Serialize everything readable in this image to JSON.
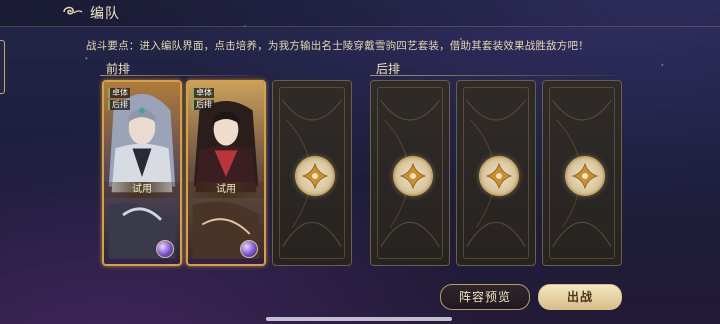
{
  "header": {
    "title": "编队"
  },
  "tip": "战斗要点：进入编队界面，点击培养，为我方输出名士陵穿戴雪驹四艺套装，借助其套装效果战胜敌方吧！",
  "sections": {
    "front": "前排",
    "back": "后排"
  },
  "front_slots": [
    {
      "tags": [
        "卓体",
        "后排"
      ],
      "trial_label": "试用"
    },
    {
      "tags": [
        "卓体",
        "后排"
      ],
      "trial_label": "试用"
    }
  ],
  "buttons": {
    "preview": "阵容预览",
    "sortie": "出战"
  },
  "colors": {
    "gold": "#c9a86a",
    "card_border": "#d9a040"
  }
}
